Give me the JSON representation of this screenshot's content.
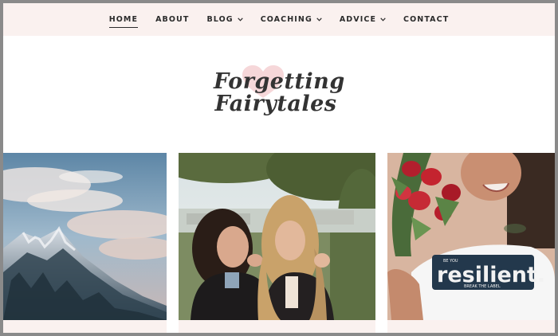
{
  "nav": {
    "items": [
      {
        "label": "HOME",
        "active": true,
        "dropdown": false
      },
      {
        "label": "ABOUT",
        "active": false,
        "dropdown": false
      },
      {
        "label": "BLOG",
        "active": false,
        "dropdown": true
      },
      {
        "label": "COACHING",
        "active": false,
        "dropdown": true
      },
      {
        "label": "ADVICE",
        "active": false,
        "dropdown": true
      },
      {
        "label": "CONTACT",
        "active": false,
        "dropdown": false
      }
    ]
  },
  "logo": {
    "line1": "Forgetting",
    "line2": "Fairytales",
    "heart_color": "#f6d7d9"
  },
  "posts": [
    {
      "image": "snowy-mountain-under-sky-photo"
    },
    {
      "image": "two-women-laughing-photo"
    },
    {
      "image": "woman-with-roses-resilient-shirt-photo",
      "shirt_text": "resilient.",
      "shirt_small_text": "BREAK THE LABEL",
      "shirt_tiny_text": "BE YOU"
    }
  ],
  "colors": {
    "nav_bg": "#faf1ef",
    "text": "#2b2b2b",
    "frame_border": "#8a8a8a"
  }
}
